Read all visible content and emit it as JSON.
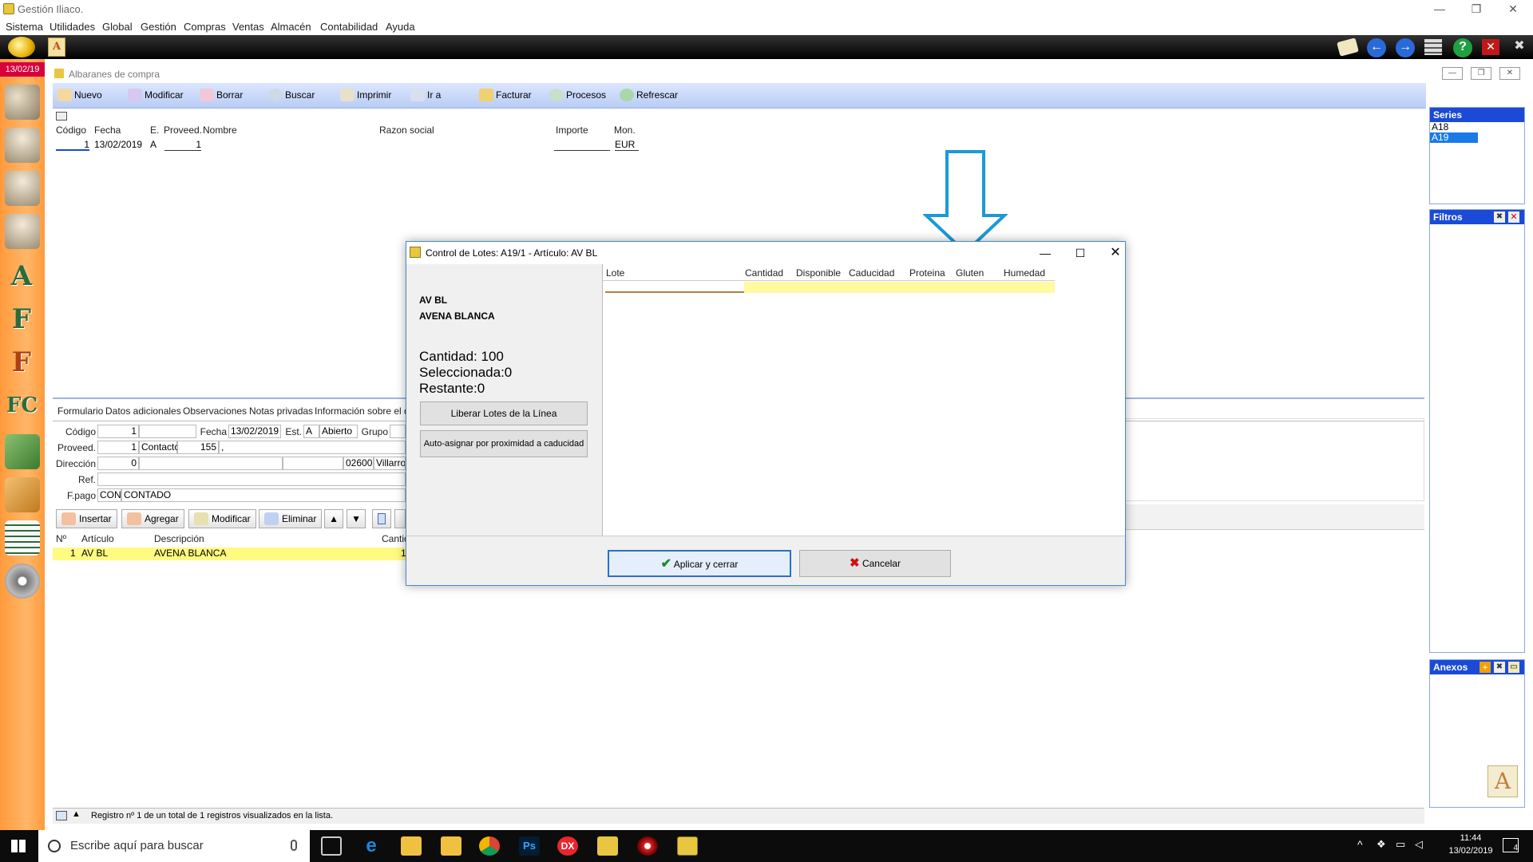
{
  "window": {
    "title": "Gestión Iliaco."
  },
  "menu": [
    "Sistema",
    "Utilidades",
    "Global",
    "Gestión",
    "Compras",
    "Ventas",
    "Almacén",
    "Contabilidad",
    "Ayuda"
  ],
  "date_badge": "13/02/19",
  "subwindow": {
    "title": "Albaranes de compra"
  },
  "toolbar": [
    "Nuevo",
    "Modificar",
    "Borrar",
    "Buscar",
    "Imprimir",
    "Ir a",
    "Facturar",
    "Procesos",
    "Refrescar"
  ],
  "list": {
    "headers": [
      "Código",
      "Fecha",
      "E.",
      "Proveed.",
      "Nombre",
      "Razon social",
      "Importe",
      "Mon."
    ],
    "row": {
      "codigo": "1",
      "fecha": "13/02/2019",
      "e": "A",
      "proveed": "1",
      "moneda": "EUR"
    }
  },
  "series": {
    "title": "Series",
    "items": [
      "A18",
      "A19"
    ]
  },
  "filtros": {
    "title": "Filtros"
  },
  "anexos": {
    "title": "Anexos"
  },
  "tabs": [
    "Formulario",
    "Datos adicionales",
    "Observaciones",
    "Notas privadas",
    "Información sobre el det"
  ],
  "form": {
    "codigo_label": "Código",
    "codigo": "1",
    "fecha_label": "Fecha",
    "fecha": "13/02/2019",
    "est_label": "Est.",
    "est": "A",
    "est_text": "Abierto",
    "grupo_label": "Grupo",
    "proveed_label": "Proveed.",
    "proveed": "1",
    "contacto_label": "Contacto",
    "contacto": "155",
    "contacto_extra": ",",
    "direccion_label": "Dirección",
    "direccion": "0",
    "cp": "02600",
    "poblacion": "Villarrob",
    "ref_label": "Ref.",
    "fpago_label": "F.pago",
    "fpago_code": "CON",
    "fpago_text": "CONTADO"
  },
  "lines_toolbar": [
    "Insertar",
    "Agregar",
    "Modificar",
    "Eliminar"
  ],
  "lines": {
    "headers": [
      "Nº",
      "Artículo",
      "Descripción",
      "Cantid"
    ],
    "row": {
      "n": "1",
      "articulo": "AV BL",
      "descripcion": "AVENA BLANCA",
      "cantidad": "1"
    }
  },
  "statusbar": "Registro nº 1 de un total de 1 registros visualizados en la lista.",
  "dialog": {
    "title": "Control de Lotes: A19/1 - Artículo: AV BL",
    "codigo": "AV BL",
    "nombre": "AVENA BLANCA",
    "cantidad": "Cantidad: 100",
    "seleccionada": "Seleccionada:0",
    "restante": "Restante:0",
    "btn_liberar": "Liberar Lotes de la Línea",
    "btn_auto": "Auto-asignar por proximidad a caducidad",
    "grid_headers": [
      "Lote",
      "Cantidad",
      "Disponible",
      "Caducidad",
      "Proteina",
      "Gluten",
      "Humedad"
    ],
    "btn_apply": "Aplicar y cerrar",
    "btn_cancel": "Cancelar"
  },
  "taskbar": {
    "search_placeholder": "Escribe aquí para buscar",
    "time": "11:44",
    "date": "13/02/2019",
    "notif": "4"
  },
  "colors": {
    "accent": "#1a4ad6",
    "arrow": "#1b9ad6",
    "highlight": "#fff9b0"
  }
}
